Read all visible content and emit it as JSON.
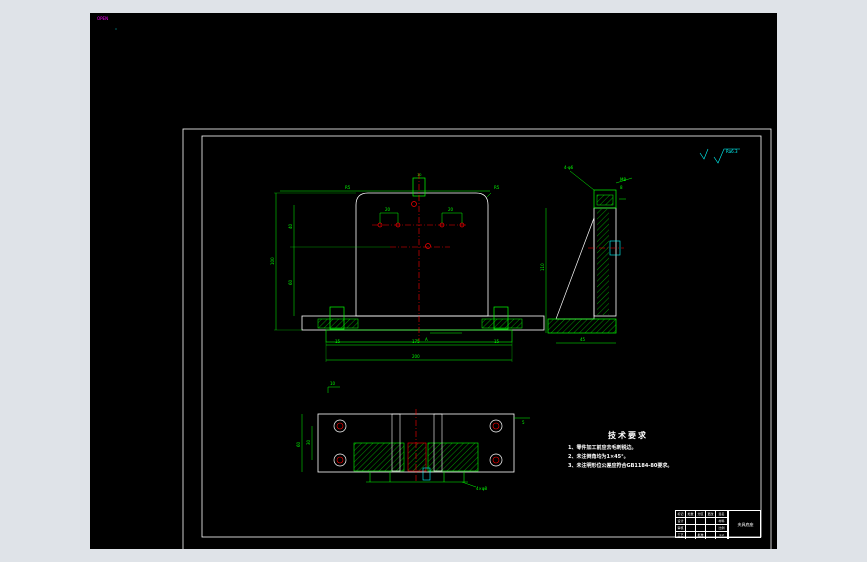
{
  "corner_label": "OPEN",
  "colors": {
    "background": "#000000",
    "frame": "#ffffff",
    "outline": "#00ff00",
    "center_line": "#ff0000",
    "hatch": "#00ff00",
    "text": "#ffffff",
    "highlight": "#ff00ff",
    "cyan": "#00ffff"
  },
  "roughness": {
    "label": "Ra6.3"
  },
  "front_view": {
    "dims": {
      "top_width": "R5",
      "corner_radius": "R5",
      "overall_height": "100",
      "upper_height": "40",
      "lower_height": "60",
      "hole_spacing_left": "20",
      "hole_spacing_right": "20",
      "base_left": "15",
      "base_width": "175",
      "base_right": "15",
      "total_width": "200",
      "slot": "10",
      "note": "A"
    }
  },
  "side_view": {
    "dims": {
      "top_label": "4-φ6",
      "thread": "M8",
      "height": "110",
      "width": "45",
      "slot": "8"
    }
  },
  "top_view": {
    "dims": {
      "top": "10",
      "left_height": "60",
      "left_inner": "30",
      "right": "5",
      "bottom_note": "4×φ8"
    }
  },
  "technical_requirements": {
    "title": "技术要求",
    "items": [
      "1、零件加工前应去毛刺锐边。",
      "2、未注倒角均为1×45°。",
      "3、未注明形位公差应符合GB1184-80要求。"
    ]
  },
  "title_block": {
    "part_name": "夹具底座",
    "cells": [
      "标记",
      "处数",
      "分区",
      "更改",
      "签名",
      "设计",
      "",
      "",
      "",
      "材料",
      "审核",
      "",
      "",
      "",
      "比例",
      "工艺",
      "",
      "批准",
      "",
      "1:2"
    ]
  }
}
